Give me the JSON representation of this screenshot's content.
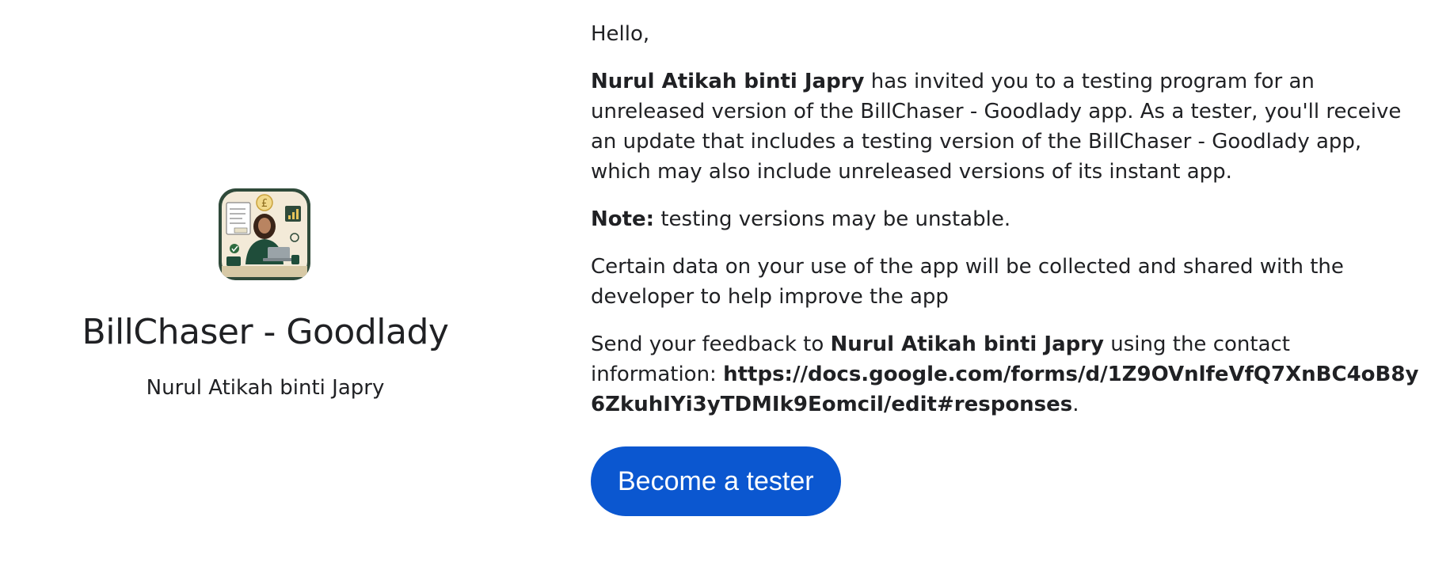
{
  "app": {
    "title": "BillChaser - Goodlady",
    "developer": "Nurul Atikah binti Japry",
    "icon": "app-icon-illustration"
  },
  "message": {
    "greeting": "Hello,",
    "invite_name": "Nurul Atikah binti Japry",
    "invite_text": " has invited you to a testing program for an unreleased version of the BillChaser - Goodlady app. As a tester, you'll receive an update that includes a testing version of the BillChaser - Goodlady app, which may also include unreleased versions of its instant app.",
    "note_label": "Note:",
    "note_text": " testing versions may be unstable.",
    "data_collection": "Certain data on your use of the app will be collected and shared with the developer to help improve the app",
    "feedback_prefix": "Send your feedback to ",
    "feedback_name": "Nurul Atikah binti Japry",
    "feedback_suffix": " using the contact information: ",
    "feedback_link": "https://docs.google.com/forms/d/1Z9OVnlfeVfQ7XnBC4oB8y6ZkuhIYi3yTDMIk9Eomcil/edit#responses",
    "feedback_end": "."
  },
  "button": {
    "label": "Become a tester",
    "color": "#0b57d0"
  }
}
